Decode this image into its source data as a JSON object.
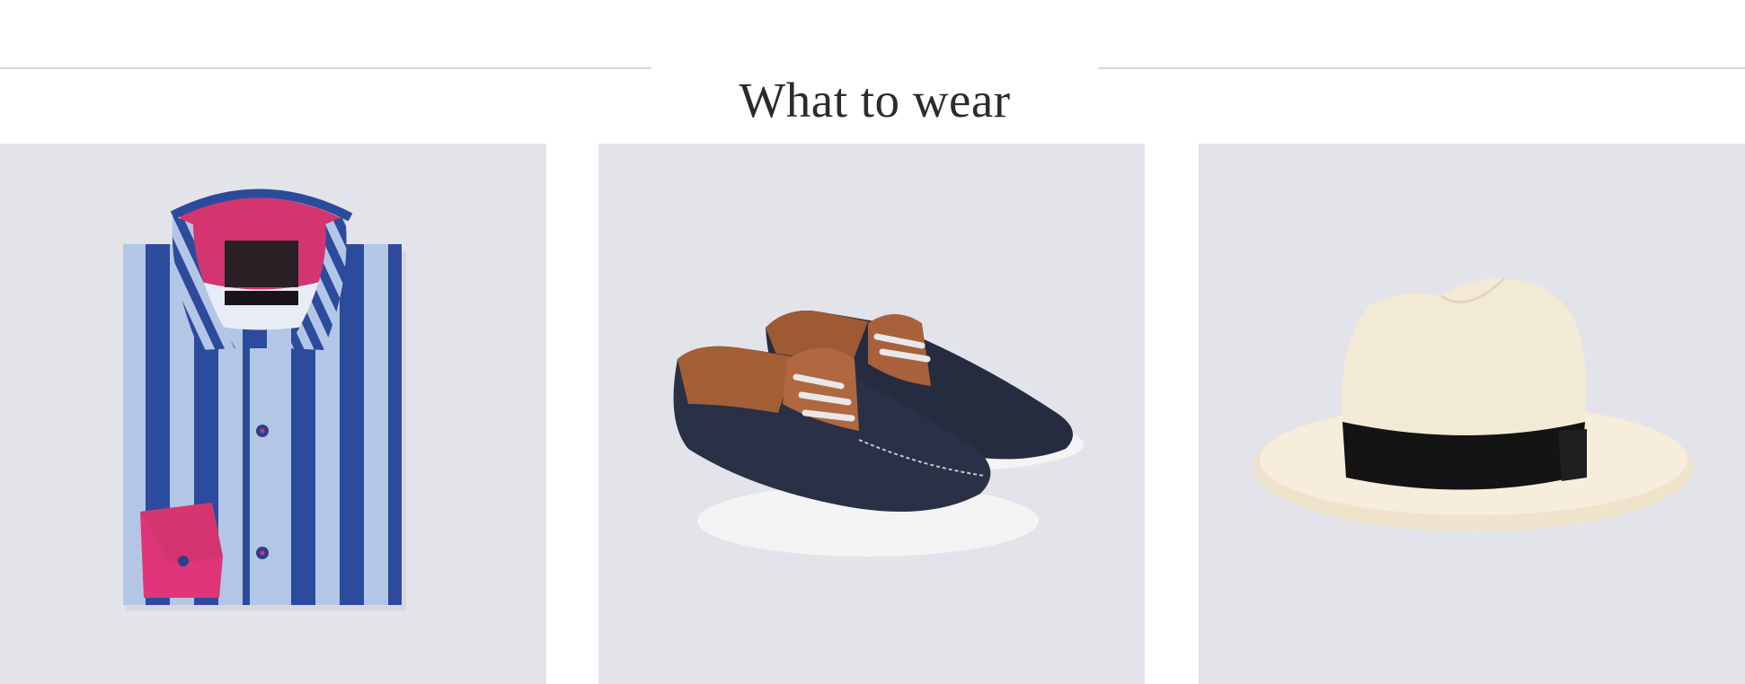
{
  "section": {
    "title": "What to wear"
  },
  "products": [
    {
      "id": "shirt",
      "icon": "striped-shirt-image",
      "label": ""
    },
    {
      "id": "shoes",
      "icon": "boat-shoes-image",
      "label": ""
    },
    {
      "id": "hat",
      "icon": "panama-hat-image",
      "label": ""
    }
  ],
  "colors": {
    "tile_background": "#e3e4e9",
    "rule": "#d6d7db",
    "title": "#2b2b2b"
  }
}
